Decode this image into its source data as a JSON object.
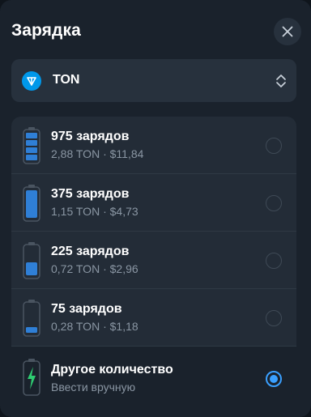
{
  "dialog": {
    "title": "Зарядка",
    "close_icon": "close-icon"
  },
  "currency_selector": {
    "label": "TON",
    "icon": "ton-logo",
    "chevron_icon": "up-down-chevron-icon"
  },
  "options": [
    {
      "title": "975 зарядов",
      "subtitle": "2,88 TON · $11,84",
      "icon": "battery-full-segmented-icon",
      "selected": false
    },
    {
      "title": "375 зарядов",
      "subtitle": "1,15 TON · $4,73",
      "icon": "battery-full-icon",
      "selected": false
    },
    {
      "title": "225 зарядов",
      "subtitle": "0,72 TON · $2,96",
      "icon": "battery-half-icon",
      "selected": false
    },
    {
      "title": "75 зарядов",
      "subtitle": "0,28 TON · $1,18",
      "icon": "battery-low-icon",
      "selected": false
    },
    {
      "title": "Другое количество",
      "subtitle": "Ввести вручную",
      "icon": "battery-lightning-icon",
      "selected": true
    }
  ],
  "colors": {
    "background": "#1a222c",
    "surface": "#232c37",
    "accent": "#3aa0ff",
    "battery": "#2f7fd6",
    "lightning": "#2ecc71",
    "muted_text": "#8a96a3"
  }
}
